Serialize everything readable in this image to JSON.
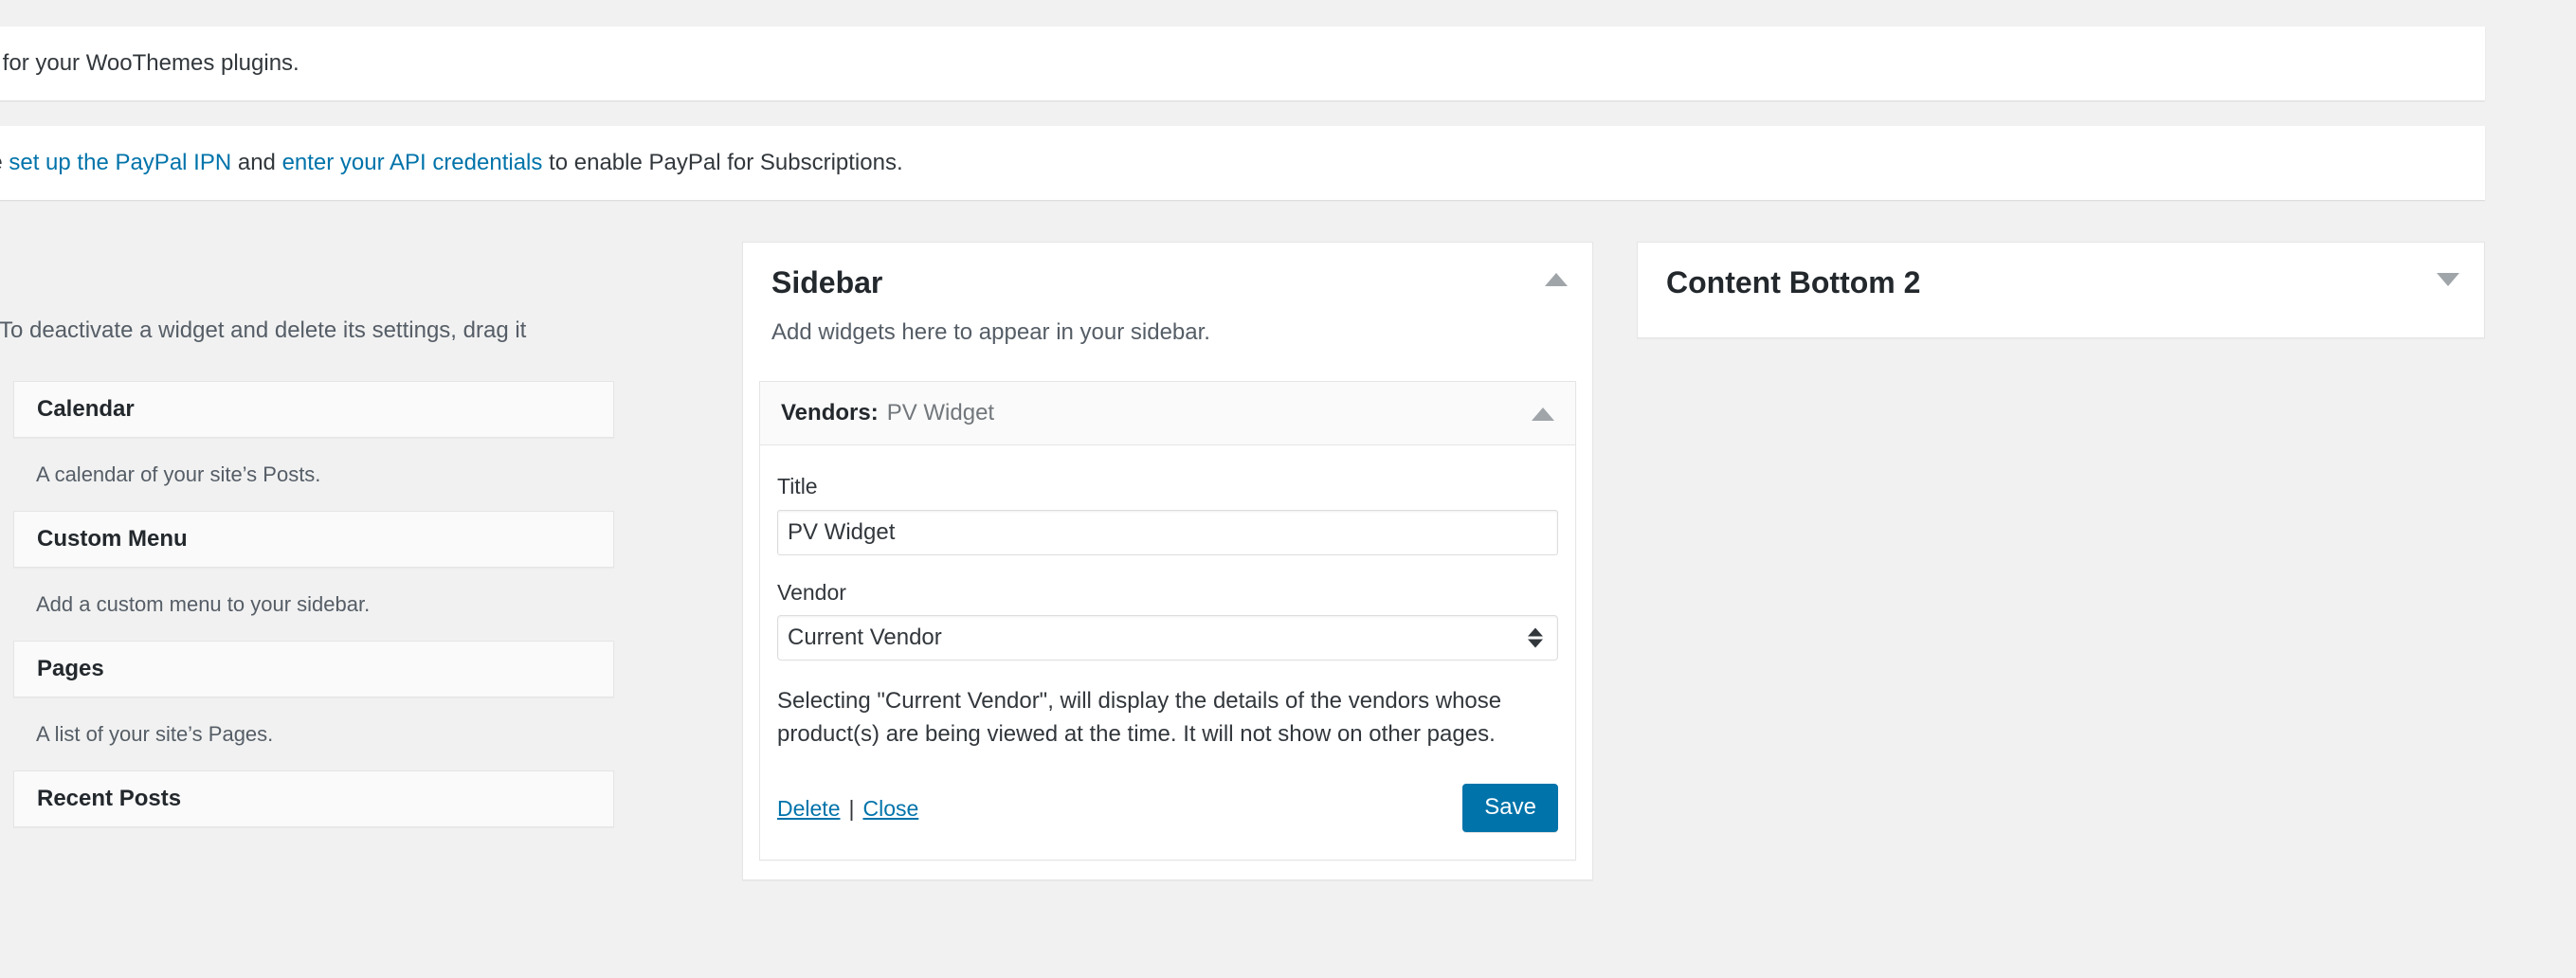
{
  "notices": [
    {
      "name": "woothemes-updates-notice",
      "segments": [
        {
          "type": "text",
          "text": "tes for your WooThemes plugins."
        }
      ]
    },
    {
      "name": "paypal-subscriptions-notice",
      "segments": [
        {
          "type": "text",
          "text": "ase "
        },
        {
          "type": "link",
          "text": "set up the PayPal IPN"
        },
        {
          "type": "text",
          "text": " and "
        },
        {
          "type": "link",
          "text": "enter your API credentials"
        },
        {
          "type": "text",
          "text": " to enable PayPal for Subscriptions."
        }
      ]
    }
  ],
  "available_widgets": {
    "intro": "To deactivate a widget and delete its settings, drag it",
    "items": [
      {
        "title": "Calendar",
        "description": "A calendar of your site’s Posts."
      },
      {
        "title": "Custom Menu",
        "description": "Add a custom menu to your sidebar."
      },
      {
        "title": "Pages",
        "description": "A list of your site’s Pages."
      },
      {
        "title": "Recent Posts",
        "description": ""
      }
    ]
  },
  "sidebar_panel": {
    "title": "Sidebar",
    "description": "Add widgets here to appear in your sidebar.",
    "toggle_icon": "chevron-up-icon",
    "open_widget": {
      "label": "Vendors:",
      "value": "PV Widget",
      "toggle_icon": "chevron-up-icon",
      "fields": {
        "title_label": "Title",
        "title_value": "PV Widget",
        "title_placeholder": "Title",
        "vendor_label": "Vendor",
        "vendor_selected": "Current Vendor",
        "vendor_options": [
          "Current Vendor"
        ],
        "stepper_icon": "updown-arrows-icon"
      },
      "help_text": "Selecting \"Current Vendor\", will display the details of the vendors whose product(s) are being viewed at the time. It will not show on other pages.",
      "controls": {
        "delete_label": "Delete",
        "separator": "|",
        "close_label": "Close",
        "save_label": "Save"
      }
    }
  },
  "content_bottom_panel": {
    "title": "Content Bottom 2",
    "toggle_icon": "chevron-down-icon"
  },
  "colors": {
    "accent": "#0073aa",
    "notice_accent": "#00a0d2",
    "page_bg": "#f1f1f1",
    "panel_bg": "#ffffff",
    "card_bg": "#fafafa",
    "border": "#e5e5e5",
    "arrow": "#a0a5aa"
  }
}
